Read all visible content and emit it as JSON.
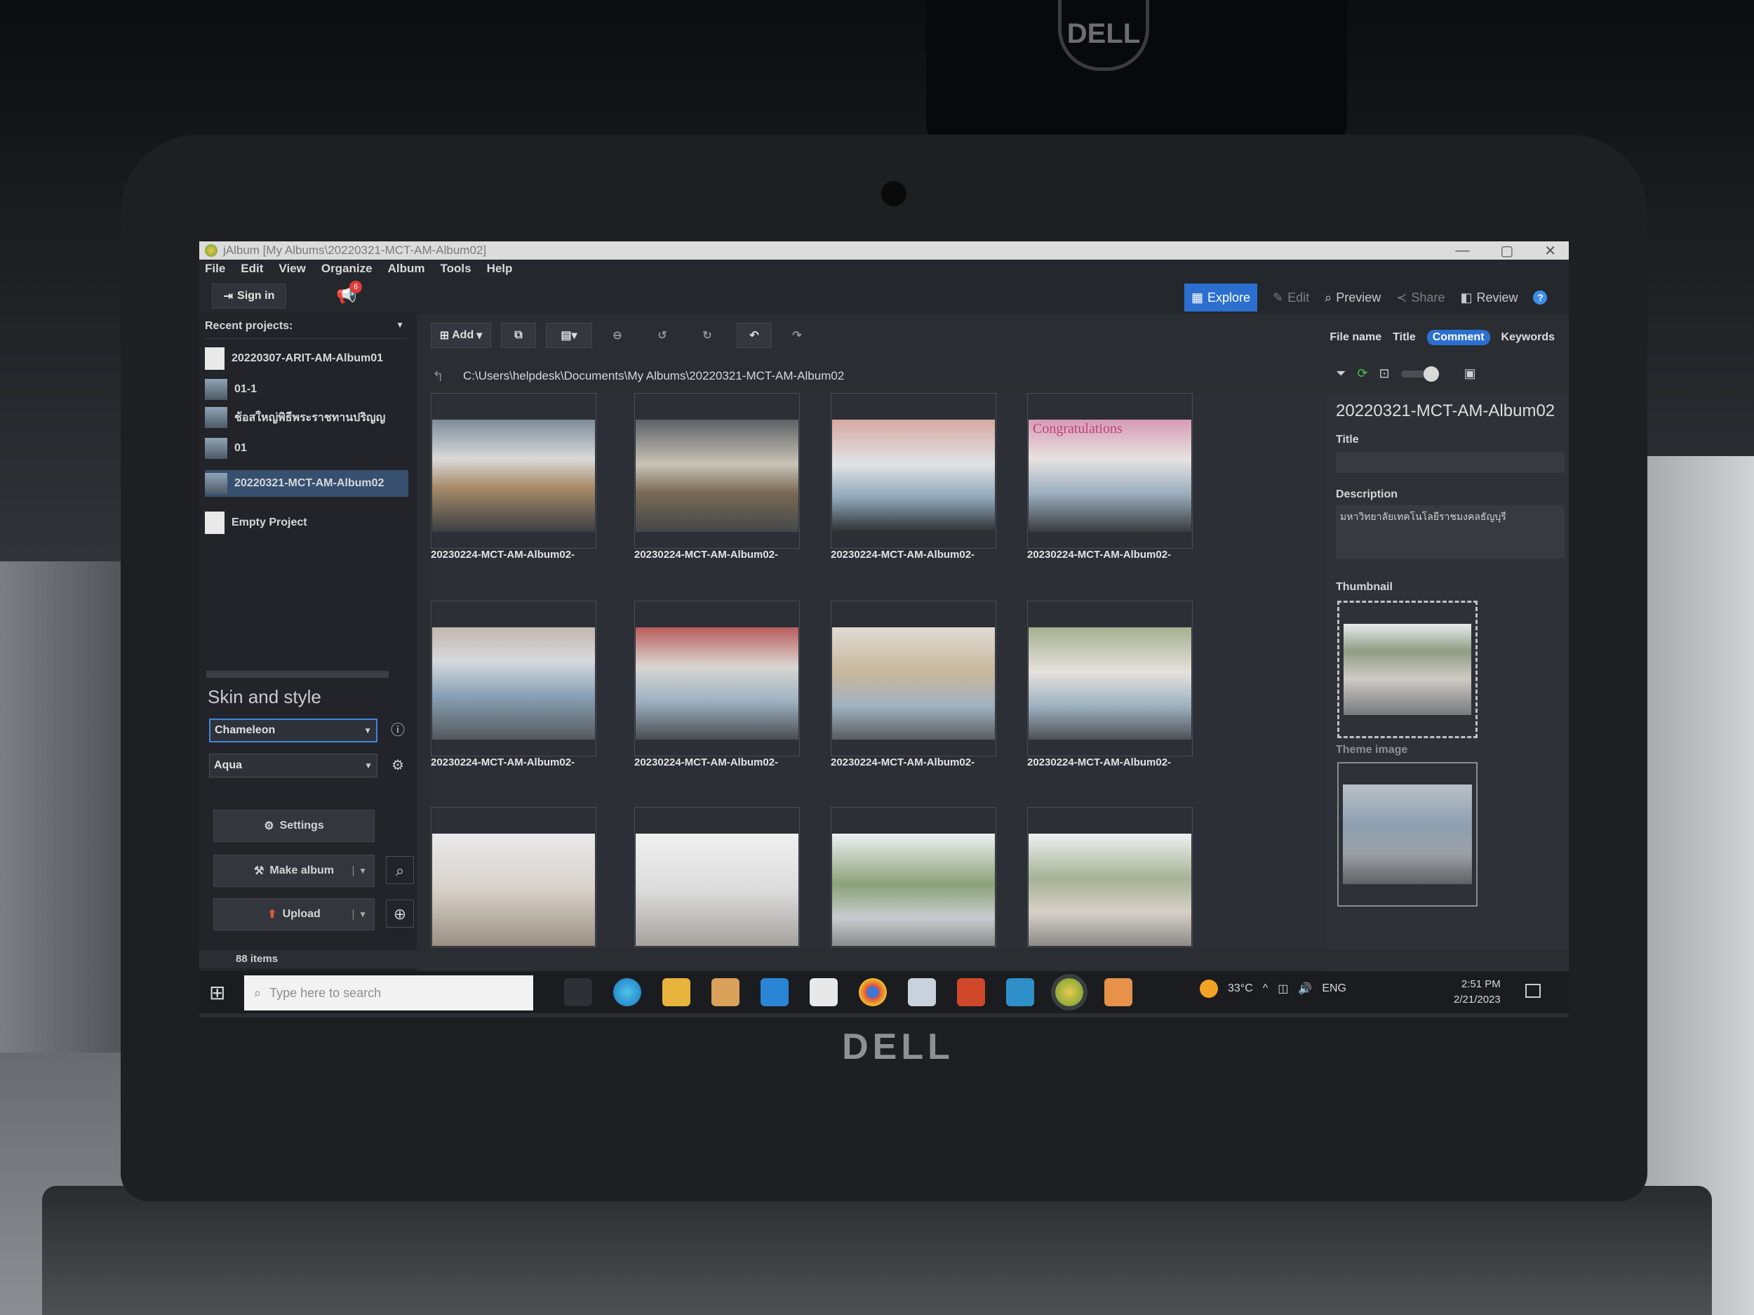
{
  "window": {
    "title": "jAlbum [My Albums\\20220321-MCT-AM-Album02]",
    "controls": [
      "—",
      "▢",
      "✕"
    ]
  },
  "menu": [
    "File",
    "Edit",
    "View",
    "Organize",
    "Album",
    "Tools",
    "Help"
  ],
  "header": {
    "sign_in": "Sign in",
    "notification_count": "6",
    "modes": [
      {
        "label": "Explore",
        "icon": "grid-icon"
      },
      {
        "label": "Edit",
        "icon": "pencil-icon"
      },
      {
        "label": "Preview",
        "icon": "magnifier-icon"
      },
      {
        "label": "Share",
        "icon": "share-icon"
      },
      {
        "label": "Review",
        "icon": "review-icon"
      }
    ],
    "help_icon": "?"
  },
  "sidebar": {
    "recent_label": "Recent projects:",
    "projects": [
      {
        "label": "20220307-ARIT-AM-Album01",
        "icon": "file-icon"
      },
      {
        "label": "01-1",
        "icon": "photo-icon"
      },
      {
        "label": "ช้อสใหญ่พิธีพระราชทานปริญญ",
        "icon": "photo-icon"
      },
      {
        "label": "01",
        "icon": "photo-icon"
      },
      {
        "label": "20220321-MCT-AM-Album02",
        "icon": "photo-icon",
        "selected": true
      },
      {
        "label": "Empty Project",
        "icon": "file-icon"
      }
    ],
    "skin_title": "Skin and style",
    "skin_value": "Chameleon",
    "style_value": "Aqua",
    "settings_label": "Settings",
    "make_album_label": "Make album",
    "upload_label": "Upload"
  },
  "toolbar": {
    "add_label": "Add",
    "sort_fields": [
      "File name",
      "Title",
      "Comment",
      "Keywords"
    ],
    "active_sort": "Comment"
  },
  "path": "C:\\Users\\helpdesk\\Documents\\My Albums\\20220321-MCT-AM-Album02",
  "grid": {
    "captions": [
      "20230224-MCT-AM-Album02-",
      "20230224-MCT-AM-Album02-",
      "20230224-MCT-AM-Album02-",
      "20230224-MCT-AM-Album02-",
      "20230224-MCT-AM-Album02-",
      "20230224-MCT-AM-Album02-",
      "20230224-MCT-AM-Album02-",
      "20230224-MCT-AM-Album02-"
    ],
    "photo_overlay_text": "Congratulations"
  },
  "details": {
    "album_name": "20220321-MCT-AM-Album02",
    "title_label": "Title",
    "title_value": "",
    "description_label": "Description",
    "description_value": "มหาวิทยาลัยเทคโนโลยีราชมงคลธัญบุรี",
    "thumbnail_label": "Thumbnail",
    "theme_image_label": "Theme image"
  },
  "status": {
    "items_count": "88 items"
  },
  "taskbar": {
    "search_placeholder": "Type here to search",
    "temperature": "33°C",
    "language": "ENG",
    "time": "2:51 PM",
    "date": "2/21/2023"
  },
  "device": {
    "laptop_brand": "DELL",
    "monitor_brand": "DELL"
  }
}
